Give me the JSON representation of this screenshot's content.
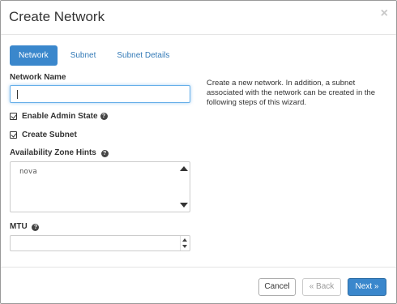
{
  "modal": {
    "title": "Create Network",
    "close_glyph": "×"
  },
  "tabs": [
    {
      "label": "Network",
      "active": true
    },
    {
      "label": "Subnet",
      "active": false
    },
    {
      "label": "Subnet Details",
      "active": false
    }
  ],
  "form": {
    "network_name_label": "Network Name",
    "network_name_value": "",
    "admin_state_label": "Enable Admin State",
    "admin_state_checked": true,
    "create_subnet_label": "Create Subnet",
    "create_subnet_checked": true,
    "az_hints_label": "Availability Zone Hints",
    "az_hints_value": "nova",
    "mtu_label": "MTU",
    "mtu_value": ""
  },
  "help_text": "Create a new network. In addition, a subnet associated with the network can be created in the following steps of this wizard.",
  "footer": {
    "cancel_label": "Cancel",
    "back_label": "Back",
    "back_glyph": "«",
    "next_label": "Next",
    "next_glyph": "»"
  },
  "icons": {
    "help": "question-circle-icon",
    "check": "check-square-icon",
    "close": "close-icon"
  },
  "colors": {
    "accent": "#3a87cc",
    "link": "#337ab7",
    "focus_border": "#66afe9"
  }
}
